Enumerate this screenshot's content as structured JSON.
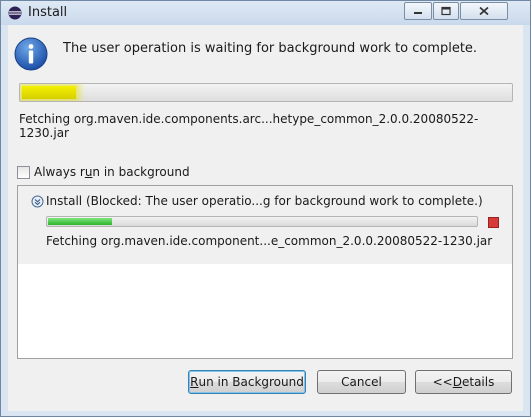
{
  "window": {
    "title": "Install"
  },
  "message": "The user operation is waiting for background work to complete.",
  "main_progress": {
    "fraction": 0.11,
    "color": "#e6e000"
  },
  "main_status": "Fetching org.maven.ide.components.arc...hetype_common_2.0.0.20080522-1230.jar",
  "always_run": {
    "checked": false,
    "label_before": "Always r",
    "label_mnemonic": "u",
    "label_after": "n in background"
  },
  "job": {
    "title": "Install (Blocked: The user operatio...g for background work to complete.)",
    "progress": {
      "fraction": 0.15,
      "color": "#2db52d"
    },
    "status": "Fetching org.maven.ide.component...e_common_2.0.0.20080522-1230.jar"
  },
  "buttons": {
    "run_in_background": {
      "before": "",
      "mnemonic": "R",
      "after": "un in Background"
    },
    "cancel": "Cancel",
    "details": {
      "before": "<< ",
      "mnemonic": "D",
      "after": "etails"
    }
  },
  "icons": {
    "title": "eclipse-icon",
    "info": "info-icon",
    "job": "job-icon",
    "stop": "stop-icon"
  }
}
